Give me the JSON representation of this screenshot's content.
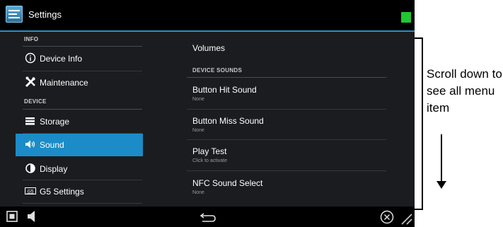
{
  "titlebar": {
    "icon": "settings-icon",
    "title": "Settings",
    "status_color": "#22c532"
  },
  "sidebar": {
    "sections": [
      {
        "header": "INFO"
      },
      {
        "header": "DEVICE"
      }
    ],
    "items": [
      {
        "label": "Device Info",
        "icon": "info-circle-icon"
      },
      {
        "label": "Maintenance",
        "icon": "tools-icon"
      },
      {
        "label": "Storage",
        "icon": "storage-icon"
      },
      {
        "label": "Sound",
        "icon": "speaker-icon",
        "active": true
      },
      {
        "label": "Display",
        "icon": "display-icon"
      },
      {
        "label": "G5 Settings",
        "icon": "g5-settings-icon"
      }
    ],
    "accent": "#1b8cc7"
  },
  "content": {
    "volumes": "Volumes",
    "section_header": "DEVICE SOUNDS",
    "items": [
      {
        "title": "Button Hit Sound",
        "subtitle": "None"
      },
      {
        "title": "Button Miss Sound",
        "subtitle": "None"
      },
      {
        "title": "Play Test",
        "subtitle": "Click to activate"
      },
      {
        "title": "NFC Sound Select",
        "subtitle": "None"
      }
    ]
  },
  "navbar": {
    "icons": [
      "square-icon",
      "volume-icon",
      "back-arrow-icon",
      "close-circle-icon",
      "resize-grip-icon"
    ]
  },
  "annotation": {
    "text": "Scroll down to see all menu item"
  }
}
